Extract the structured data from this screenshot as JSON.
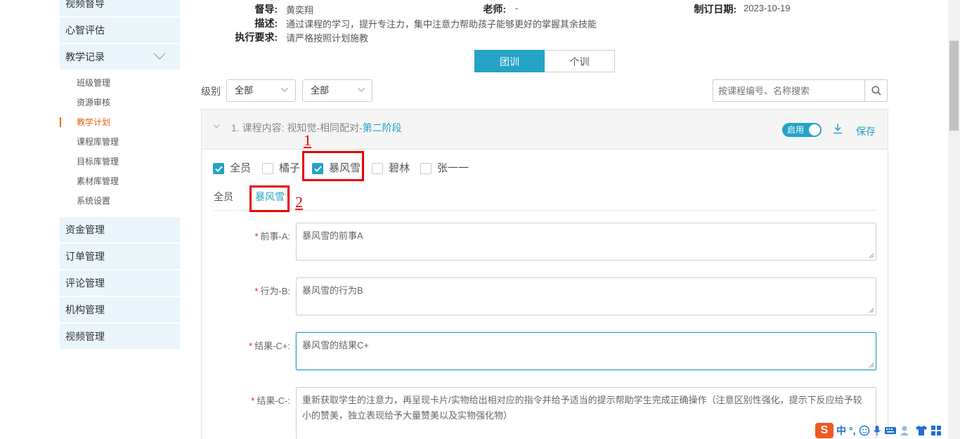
{
  "sidebar": {
    "main_items": [
      {
        "label": "视频督导"
      },
      {
        "label": "心智评估"
      },
      {
        "label": "教学记录"
      },
      {
        "label": "资金管理"
      },
      {
        "label": "订单管理"
      },
      {
        "label": "评论管理"
      },
      {
        "label": "机构管理"
      },
      {
        "label": "视频管理"
      }
    ],
    "sub_items": [
      {
        "label": "班级管理"
      },
      {
        "label": "资源审核"
      },
      {
        "label": "教学计划",
        "active": true
      },
      {
        "label": "课程库管理"
      },
      {
        "label": "目标库管理"
      },
      {
        "label": "素材库管理"
      },
      {
        "label": "系统设置"
      }
    ]
  },
  "info": {
    "supervisor_label": "督导:",
    "supervisor_value": "黄奕翔",
    "teacher_label": "老师:",
    "teacher_value": "-",
    "date_label": "制订日期:",
    "date_value": "2023-10-19",
    "desc_label": "描述:",
    "desc_value": "通过课程的学习，提升专注力，集中注意力帮助孩子能够更好的掌握其余技能",
    "req_label": "执行要求:",
    "req_value": "请严格按照计划施教"
  },
  "mode_tabs": {
    "team": "团训",
    "individual": "个训"
  },
  "filter": {
    "level_label": "级别",
    "select1": "全部",
    "select2": "全部",
    "search_placeholder": "按课程编号、名称搜索"
  },
  "panel": {
    "title_prefix": "1. 课程内容: 视知觉-相同配对-",
    "title_highlight": "第二阶段",
    "toggle_label": "启用",
    "save_label": "保存"
  },
  "members": [
    {
      "label": "全员",
      "checked": true
    },
    {
      "label": "橘子",
      "checked": false
    },
    {
      "label": "暴风雪",
      "checked": true
    },
    {
      "label": "碧林",
      "checked": false
    },
    {
      "label": "张一一",
      "checked": false
    }
  ],
  "sub_tabs": [
    {
      "label": "全员"
    },
    {
      "label": "暴风雪",
      "active": true
    }
  ],
  "annotations": {
    "one": "1",
    "two": "2"
  },
  "form": [
    {
      "label": "前事-A:",
      "value": "暴风雪的前事A"
    },
    {
      "label": "行为-B:",
      "value": "暴风雪的行为B"
    },
    {
      "label": "结果-C+:",
      "value": "暴风雪的结果C+"
    },
    {
      "label": "结果-C-:",
      "value": "重新获取学生的注意力，再呈现卡片/实物给出相对应的指令并给予适当的提示帮助学生完成正确操作（注意区别性强化，提示下反应给予较小的赞美，独立表现给予大量赞美以及实物强化物）"
    }
  ],
  "ime": {
    "logo": "S",
    "lang": "中",
    "punct": "°,"
  },
  "colors": {
    "accent": "#24a3c6",
    "annotation": "#e60000",
    "active_sub": "#e8641c"
  }
}
